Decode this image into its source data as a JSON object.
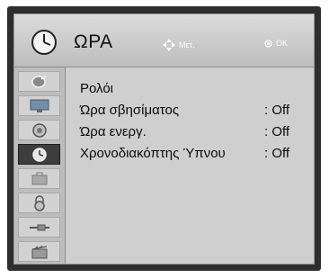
{
  "header": {
    "title": "ΩΡΑ",
    "move_hint": "Μετ.",
    "ok_hint": "OK"
  },
  "sidebar": {
    "items": [
      {
        "icon": "satellite-dish-icon"
      },
      {
        "icon": "monitor-icon"
      },
      {
        "icon": "speaker-icon"
      },
      {
        "icon": "clock-icon",
        "active": true
      },
      {
        "icon": "briefcase-icon"
      },
      {
        "icon": "lock-icon"
      },
      {
        "icon": "cable-icon"
      },
      {
        "icon": "clapperboard-icon"
      }
    ]
  },
  "menu": {
    "items": [
      {
        "label": "Ρολόι",
        "value": ""
      },
      {
        "label": "Ώρα σβησίματος",
        "value": ": Off"
      },
      {
        "label": "Ώρα ενεργ.",
        "value": ": Off"
      },
      {
        "label": "Χρονοδιακόπτης Ύπνου",
        "value": ": Off"
      }
    ]
  }
}
